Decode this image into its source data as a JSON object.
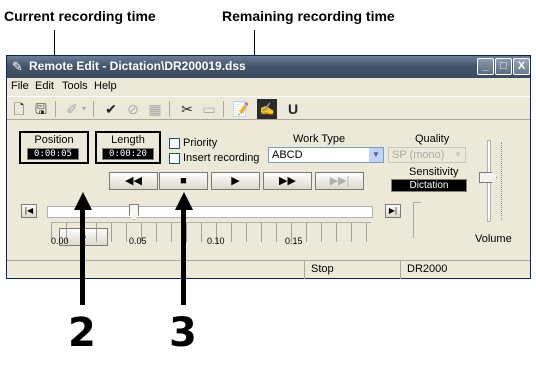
{
  "callouts": {
    "current_time": "Current recording time",
    "remaining_time": "Remaining recording time",
    "step_a": "2",
    "step_b": "3"
  },
  "window": {
    "title": "Remote Edit - Dictation\\DR200019.dss",
    "title_icon": "pen-icon",
    "controls": [
      "_",
      "□",
      "X"
    ]
  },
  "menu": [
    "File",
    "Edit",
    "Tools",
    "Help"
  ],
  "toolbar": {
    "icons": [
      "new-file-icon",
      "save-icon",
      "template-icon",
      "check-icon",
      "cancel-circle-icon",
      "grid-icon",
      "tools-icon",
      "folder-icon",
      "notepad-icon",
      "edit-icon",
      "u-turn-icon"
    ]
  },
  "position": {
    "label": "Position",
    "value": "0:00:05"
  },
  "length": {
    "label": "Length",
    "value": "0:00:20"
  },
  "options": {
    "priority": "Priority",
    "insert": "Insert recording"
  },
  "work_type": {
    "label": "Work Type",
    "value": "ABCD"
  },
  "quality": {
    "label": "Quality",
    "value": "SP (mono)"
  },
  "sensitivity": {
    "label": "Sensitivity",
    "value": "Dictation"
  },
  "transport": {
    "record": "●",
    "rewind": "◀◀",
    "stop": "■",
    "play": "▶",
    "fast_forward": "▶▶",
    "end": "▶▶|"
  },
  "timeline": {
    "start_btn": "|◀",
    "end_btn": "▶|",
    "ticks": [
      "0.00",
      "0.05",
      "0.10",
      "0.15"
    ]
  },
  "volume": {
    "label": "Volume"
  },
  "status": {
    "state": "Stop",
    "device": "DR2000"
  },
  "colors": {
    "title_bar": "#44556e",
    "window_bg": "#ece9d8",
    "lcd_bg": "#000000"
  }
}
